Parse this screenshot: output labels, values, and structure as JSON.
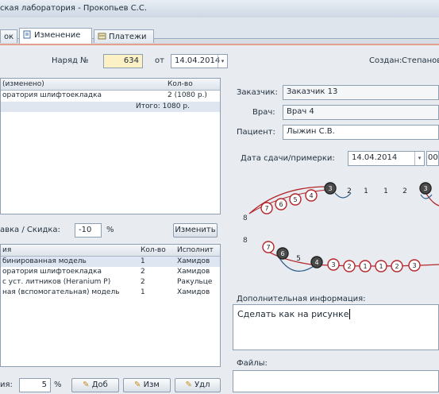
{
  "window": {
    "title": "ская лаборатория - Прокопьев С.С."
  },
  "tabs": [
    {
      "label": "ок"
    },
    {
      "label": "Изменение"
    },
    {
      "label": "Платежи"
    }
  ],
  "order": {
    "number_label": "Наряд №",
    "number_value": "634",
    "date_from_label": "от",
    "date_value": "14.04.2014",
    "created_label": "Создан:",
    "created_value": "Степанов С."
  },
  "top_grid": {
    "headers": [
      "(изменено)",
      "Кол-во"
    ],
    "rows": [
      [
        "оратория шлифтоекладка",
        "2 (1080 р.)"
      ]
    ],
    "total": "Итого: 1080 р."
  },
  "discount": {
    "label": "авка / Скидка:",
    "value": "-10",
    "unit": "%",
    "change_button": "Изменить"
  },
  "bottom_grid": {
    "headers": [
      "ия",
      "Кол-во",
      "Исполнит"
    ],
    "rows": [
      [
        "бинированная модель",
        "1",
        "Хамидов"
      ],
      [
        "оратория шлифтоекладка",
        "2",
        "Хамидов"
      ],
      [
        "с уст. литников (Heranium P)",
        "2",
        "Ракульце"
      ],
      [
        "ная (вспомогательная) модель",
        "1",
        "Хамидов"
      ]
    ]
  },
  "footer": {
    "label": "ия:",
    "value": "5",
    "unit": "%",
    "add_button": "Доб",
    "edit_button": "Изм",
    "delete_button": "Удл"
  },
  "form": {
    "customer_label": "Заказчик:",
    "customer_value": "Заказчик 13",
    "doctor_label": "Врач:",
    "doctor_value": "Врач 4",
    "patient_label": "Пациент:",
    "patient_value": "Лыжин С.В.",
    "delivery_label": "Дата сдачи/примерки:",
    "delivery_date": "14.04.2014",
    "delivery_time": "00",
    "info_label": "Дополнительная информация:",
    "info_value": "Сделать как на рисунке",
    "files_label": "Файлы:"
  },
  "teeth": {
    "upper_left": [
      "7",
      "6",
      "5",
      "4",
      "3"
    ],
    "upper_mid": [
      "2",
      "1",
      "1",
      "2"
    ],
    "upper_right": [
      "3"
    ],
    "side_upper": "8",
    "side_lower": "8",
    "lower_left": [
      "7",
      "6",
      "5",
      "4",
      "3",
      "2",
      "1",
      "1",
      "2",
      "3"
    ]
  },
  "colors": {
    "accent": "#e0a08c",
    "tooth_red": "#b3262b",
    "tooth_dark": "#4a4a4a"
  }
}
